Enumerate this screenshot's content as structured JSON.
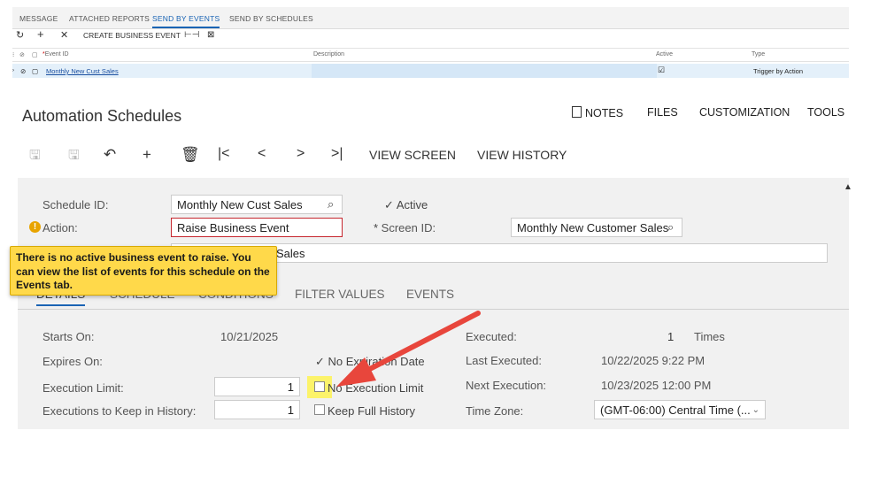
{
  "top_grid": {
    "tabs": [
      {
        "label": "MESSAGE",
        "active": false
      },
      {
        "label": "ATTACHED REPORTS",
        "active": false
      },
      {
        "label": "SEND BY EVENTS",
        "active": true
      },
      {
        "label": "SEND BY SCHEDULES",
        "active": false
      }
    ],
    "toolbar": {
      "create_label": "CREATE BUSINESS EVENT"
    },
    "columns": {
      "event_id": "Event ID",
      "description": "Description",
      "active": "Active",
      "type": "Type"
    },
    "row": {
      "event_id": "Monthly New Cust Sales",
      "description": "",
      "active": "☑",
      "type": "Trigger by Action"
    }
  },
  "screen": {
    "title": "Automation Schedules",
    "menu": {
      "notes": "NOTES",
      "files": "FILES",
      "customization": "CUSTOMIZATION",
      "tools": "TOOLS"
    },
    "toolbar": {
      "view_screen": "VIEW SCREEN",
      "view_history": "VIEW HISTORY"
    }
  },
  "form": {
    "schedule_id_label": "Schedule ID:",
    "schedule_id_value": "Monthly New Cust Sales",
    "active_label": "Active",
    "action_label": "Action:",
    "action_value": "Raise Business Event",
    "screen_id_label": "Screen ID:",
    "screen_id_value": "Monthly New Customer Sales",
    "description_value": "Sales"
  },
  "tooltip": {
    "message": "There is no active business event to raise. You can view the list of events for this schedule on the Events tab."
  },
  "subtabs": [
    "DETAILS",
    "SCHEDULE",
    "CONDITIONS",
    "FILTER VALUES",
    "EVENTS"
  ],
  "details": {
    "starts_on_label": "Starts On:",
    "starts_on_value": "10/21/2025",
    "expires_on_label": "Expires On:",
    "no_expiration_label": "No Expiration Date",
    "execution_limit_label": "Execution Limit:",
    "execution_limit_value": "1",
    "no_execution_limit_label": "No Execution Limit",
    "keep_history_label": "Executions to Keep in History:",
    "keep_history_value": "1",
    "keep_full_history_label": "Keep Full History",
    "executed_label": "Executed:",
    "executed_value": "1",
    "executed_unit": "Times",
    "last_executed_label": "Last Executed:",
    "last_executed_value": "10/22/2025 9:22 PM",
    "next_execution_label": "Next Execution:",
    "next_execution_value": "10/23/2025 12:00 PM",
    "time_zone_label": "Time Zone:",
    "time_zone_value": "(GMT-06:00) Central Time (..."
  },
  "colors": {
    "accent": "#1a64b4",
    "tooltip_bg": "#ffd94a",
    "error_border": "#c6262e",
    "arrow": "#e8463c",
    "highlight": "#fcf36a"
  }
}
